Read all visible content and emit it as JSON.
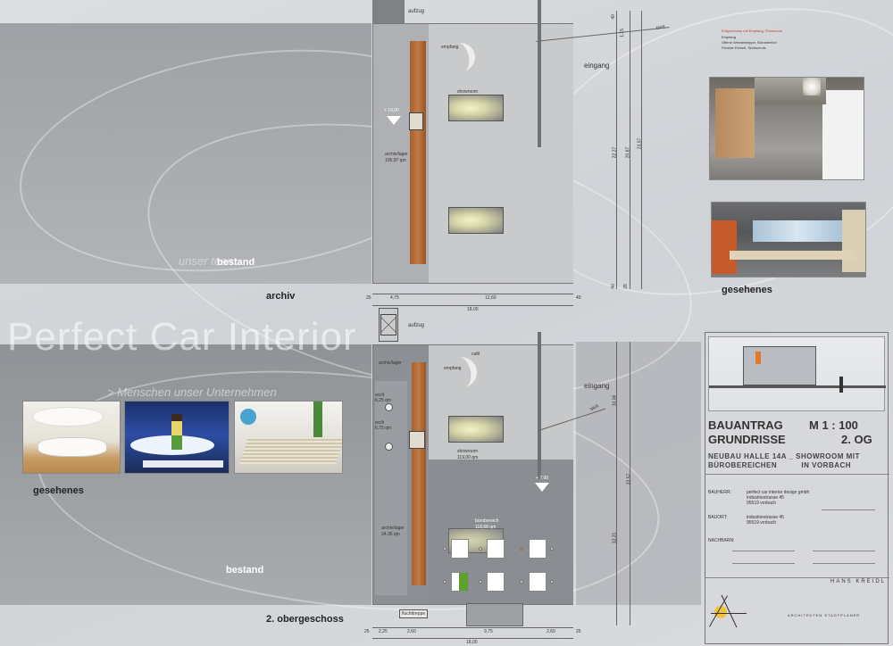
{
  "labels": {
    "bestand_top": "bestand",
    "bestand_bottom": "bestand",
    "archiv": "archiv",
    "obergeschoss": "2. obergeschoss",
    "gesehenes_left": "gesehenes",
    "gesehenes_right": "gesehenes",
    "ghost_title": "Perfect Car Interior",
    "ghost_sub": "> Menschen unser Unternehmen",
    "ghost_sub2": "unser team"
  },
  "plan_top": {
    "aufzug": "aufzug",
    "empfang": "empfang",
    "eingang": "eingang",
    "level": "+ 10,00",
    "archiv_lager": "archiv/lager",
    "area": "105,97 qm",
    "blick": "blick",
    "showroom_lbl": "showroom",
    "dims": [
      "4,75",
      "12,60",
      "18,00",
      "25",
      "40"
    ],
    "vert_dims": [
      "40",
      "1,15",
      "22,27",
      "20,87",
      "23,57",
      "40",
      "25"
    ]
  },
  "plan_bottom": {
    "aufzug": "aufzug",
    "cafe": "café",
    "empfang": "empfang",
    "eingang": "eingang",
    "archiv_lager_top": "archiv/lager",
    "wc1": "wc/d\n6,25 qm",
    "wc2": "wc/h\n6,75 qm",
    "showroom": "showroom",
    "showroom_area": "119,00 qm",
    "level": "+ 7,00",
    "buero": "bürobereich",
    "buero_area": "118,68 qm",
    "archiv_lager": "archiv/lager",
    "archiv_area": "34,36 qm",
    "fluchttreppe": "fluchttreppe",
    "blick": "blick",
    "dims": [
      "25",
      "2,25",
      "2,60",
      "9,75",
      "2,60",
      "25",
      "18,00"
    ],
    "vert_dims": [
      "10,06",
      "23,57",
      "12,21"
    ]
  },
  "credits_top": [
    "Erdgeschoss mit Empfang, Showroom",
    "Empfang",
    "Offene Wendeltreppe, Bürobereich",
    "Flexible Einheit, Sichtschutz"
  ],
  "titleblock": {
    "bauantrag": "BAUANTRAG",
    "scale": "M 1 : 100",
    "grundrisse": "GRUNDRISSE",
    "og": "2. OG",
    "project_line1": "NEUBAU HALLE 14A _ SHOWROOM MIT",
    "project_line2": "BÜROBEREICHEN          IN VORBACH",
    "bauherr_lbl": "BAUHERR:",
    "bauherr_val": [
      "perfect car interior design gmbh",
      "industriestrasse 45",
      "95519 vorbach"
    ],
    "bauort_lbl": "BAUORT:",
    "bauort_val": [
      "industriestrasse 45",
      "95519 vorbach"
    ],
    "nachbarn_lbl": "NACHBARN:",
    "architect": "HANS KREIDL",
    "architect_sub": "ARCHITEKTEN STADTPLANER"
  },
  "colors": {
    "wood": "#b06a36",
    "band": "#a7aaae",
    "background": "#d4d6d9",
    "green_desk": "#5aa12e"
  }
}
